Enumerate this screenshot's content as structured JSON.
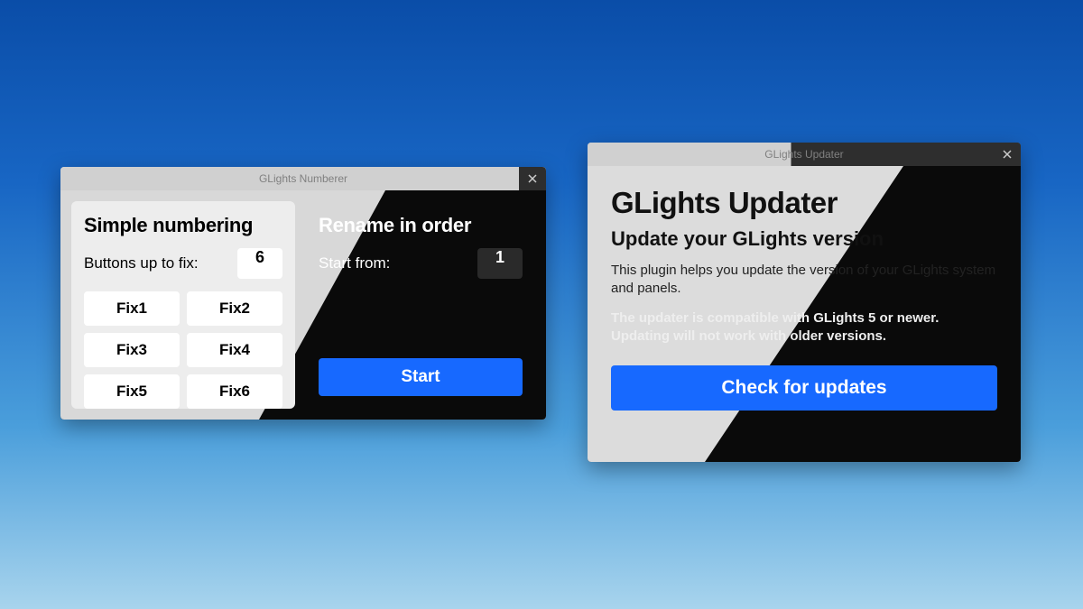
{
  "numberer": {
    "title": "GLights Numberer",
    "simple": {
      "heading": "Simple numbering",
      "field_label": "Buttons up to fix:",
      "value": "6",
      "buttons": [
        "Fix1",
        "Fix2",
        "Fix3",
        "Fix4",
        "Fix5",
        "Fix6"
      ]
    },
    "rename": {
      "heading": "Rename in order",
      "field_label": "Start from:",
      "value": "1",
      "start_button": "Start"
    }
  },
  "updater": {
    "title": "GLights Updater",
    "heading": "GLights Updater",
    "subheading": "Update your GLights version",
    "description": "This plugin helps you update the version of your GLights system and panels.",
    "compat_note": "The updater is compatible with GLights 5 or newer. Updating will not work with older versions.",
    "check_button": "Check for updates"
  }
}
